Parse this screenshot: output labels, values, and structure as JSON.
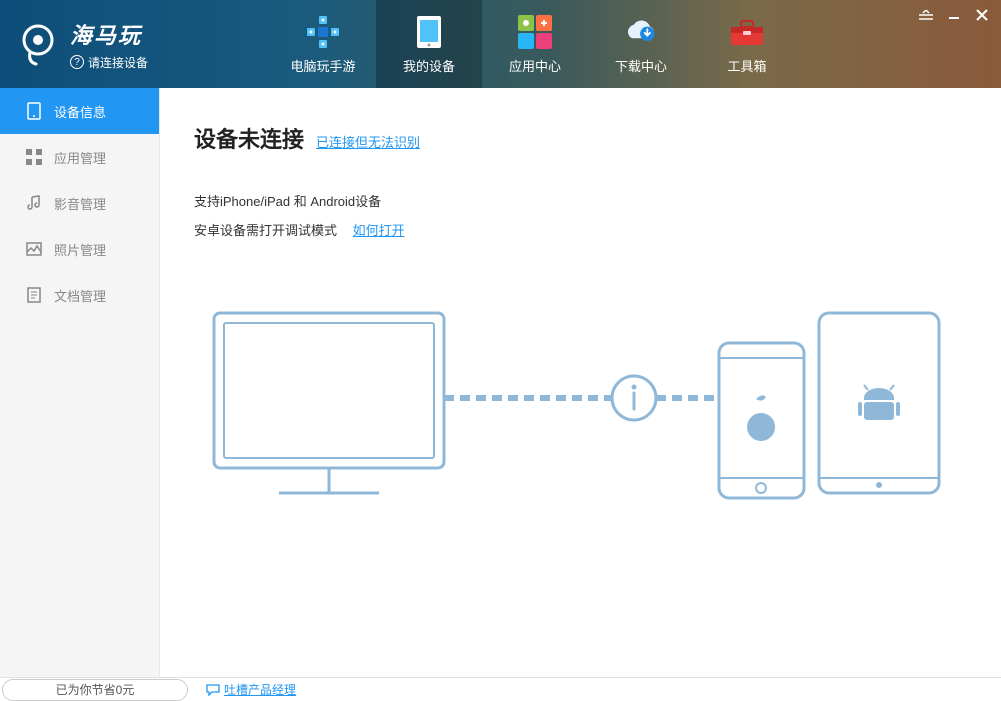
{
  "brand": {
    "title": "海马玩",
    "subtitle": "请连接设备"
  },
  "nav": [
    {
      "label": "电脑玩手游"
    },
    {
      "label": "我的设备"
    },
    {
      "label": "应用中心"
    },
    {
      "label": "下载中心"
    },
    {
      "label": "工具箱"
    }
  ],
  "sidebar": [
    {
      "label": "设备信息"
    },
    {
      "label": "应用管理"
    },
    {
      "label": "影音管理"
    },
    {
      "label": "照片管理"
    },
    {
      "label": "文档管理"
    }
  ],
  "content": {
    "title": "设备未连接",
    "title_link": "已连接但无法识别",
    "support_text": "支持iPhone/iPad 和 Android设备",
    "android_text": "安卓设备需打开调试模式",
    "android_link": "如何打开"
  },
  "statusbar": {
    "saved": "已为你节省0元",
    "feedback": "吐槽产品经理"
  }
}
